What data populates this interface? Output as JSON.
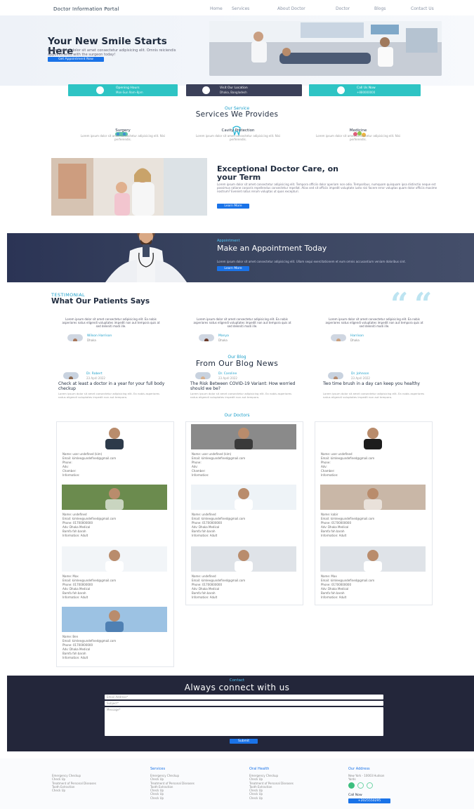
{
  "header": {
    "brand": "Doctor Information Portal",
    "nav": [
      "Home",
      "Services",
      "About Doctor",
      "Doctor",
      "Blogs",
      "Contact Us"
    ]
  },
  "hero": {
    "title": "Your New Smile Starts Here",
    "text": "Lorem ipsum dolor sit amet consectetur adipisicing elit. Omnis reiciendis appointments with the surgeon today!",
    "button": "Get Appointment Now"
  },
  "info_cards": [
    {
      "title": "Opening Hours",
      "sub": "Mon-Sun 9am–8pm",
      "color": "#2ec4c4",
      "icon": "clock-icon"
    },
    {
      "title": "Visit Our Location",
      "sub": "Dhaka, Bangladesh",
      "color": "#3b4059",
      "icon": "location-pin-icon"
    },
    {
      "title": "Call Us Now",
      "sub": "+880000000",
      "color": "#2ec4c4",
      "icon": "phone-icon"
    }
  ],
  "services": {
    "eyebrow": "Our Service",
    "title": "Services We Provides",
    "items": [
      {
        "name": "Surgery",
        "text": "Lorem ipsum dolor sit amet consectetur adipisicing elit. Nisi perferendis."
      },
      {
        "name": "Cavity Protection",
        "text": "Lorem ipsum dolor sit amet consectetur adipisicing elit. Nisi perferendis."
      },
      {
        "name": "Medicine",
        "text": "Lorem ipsum dolor sit amet consectetur adipisicing elit. Nisi perferendis."
      }
    ]
  },
  "exceptional": {
    "title": "Exceptional Doctor Care, on your Term",
    "text": "Lorem ipsum dolor sit amet consectetur adipisicing elit. Tempora officiis dolor aperiam non odio. Temporibus, numquam quisquam ipsa distinctio neque est possimus ratione corporis repellendus consectetur repellat. Alias sed sit officiis impedit voluptate iusto nisi facere error voluptas quam dolor officiis maxime nostrum? Eveniet natus rerum voluptas ut quos excepturi.",
    "button": "Learn More"
  },
  "appointment": {
    "eyebrow": "Appointment",
    "title": "Make an Appointment Today",
    "text": "Lorem ipsum dolor sit amet consectetur adipisicing elit. Ullam sequi exercitationem et eum omnis accusantium veniam doloribus sint.",
    "button": "Learn More"
  },
  "testimonial": {
    "eyebrow": "TESTIMONIAL",
    "title": "What Our Patients Says",
    "items": [
      {
        "text": "Lorem ipsum dolor sit amet consectetur adipisicing elit. Ea nobis asperiores natus eligendi voluptates impedit non aut tempora quis at sed deleniti modi ille.",
        "name": "Wilson Harrison",
        "role": "Dhaka"
      },
      {
        "text": "Lorem ipsum dolor sit amet consectetur adipisicing elit. Ea nobis asperiores natus eligendi voluptates impedit non aut tempora quis at sed deleniti modi ille.",
        "name": "Manya",
        "role": "Dhaka"
      },
      {
        "text": "Lorem ipsum dolor sit amet consectetur adipisicing elit. Ea nobis asperiores natus eligendi voluptates impedit non aut tempora quis at sed deleniti modi ille.",
        "name": "Harrison",
        "role": "Dhaka"
      }
    ]
  },
  "blog": {
    "eyebrow": "Our Blog",
    "title": "From Our Blog News",
    "posts": [
      {
        "author": "Dr. Robert",
        "date": "23 April 2022",
        "title": "Check at least a doctor in a year for your full body checkup",
        "excerpt": "Lorem ipsum dolor sit amet consectetur adipisicing elit. Ea nobis asperiores natus eligendi voluptates impedit non aut tempora."
      },
      {
        "author": "Dr. Caroline",
        "date": "23 April 2022",
        "title": "The Risk Between COVID-19 Variant: How worried should we be?",
        "excerpt": "Lorem ipsum dolor sit amet consectetur adipisicing elit. Ea nobis asperiores natus eligendi voluptates impedit non aut tempora."
      },
      {
        "author": "Dr. Johnson",
        "date": "23 April 2022",
        "title": "Two time brush in a day can keep you healthy",
        "excerpt": "Lorem ipsum dolor sit amet consectetur adipisicing elit. Ea nobis asperiores natus eligendi voluptates impedit non aut tempora."
      }
    ]
  },
  "doctors": {
    "eyebrow": "Our Doctors",
    "items": [
      {
        "name": "Name: user undefined (kim)",
        "email": "Email: kimlee@undefined@gmail.com",
        "phone": "Phone: ",
        "loc": "Adv: ",
        "chamber": "Chamber: ",
        "info": "Information: "
      },
      {
        "name": "Name: user undefined (kim)",
        "email": "Email: kimlee@undefined@gmail.com",
        "phone": "Phone: ",
        "loc": "Adv: ",
        "chamber": "Chamber: ",
        "info": "Information: "
      },
      {
        "name": "Name: user undefined",
        "email": "Email: kimlee@undefined@gmail.com",
        "phone": "Phone: ",
        "loc": "Adv: ",
        "chamber": "Chamber: ",
        "info": "Information: "
      },
      {
        "name": "Name: undefined",
        "email": "Email: kimlee@undefined@gmail.com",
        "phone": "Phone: 01700000000",
        "loc": "Adv: Dhaka Medical",
        "chamber": "Bamfa fah barah",
        "info": "Information: Adult"
      },
      {
        "name": "Name: undefined",
        "email": "Email: kimlee@undefined@gmail.com",
        "phone": "Phone: 01700000000",
        "loc": "Adv: Dhaka Medical",
        "chamber": "Bamfa fah barah",
        "info": "Information: Adult"
      },
      {
        "name": "Name: kabir",
        "email": "Email: kimlee@undefined@gmail.com",
        "phone": "Phone: 01700000000",
        "loc": "Adv: Dhaka Medical",
        "chamber": "Bamfa fah barah",
        "info": "Information: Adult"
      },
      {
        "name": "Name: Max",
        "email": "Email: kimlee@undefined@gmail.com",
        "phone": "Phone: 01700000000",
        "loc": "Adv: Dhaka Medical",
        "chamber": "Bamfa fah barah",
        "info": "Information: Adult"
      },
      {
        "name": "Name: undefined",
        "email": "Email: kimlee@undefined@gmail.com",
        "phone": "Phone: 01700000000",
        "loc": "Adv: Dhaka Medical",
        "chamber": "Bamfa fah barah",
        "info": "Information: Adult"
      },
      {
        "name": "Name: Max",
        "email": "Email: kimlee@undefined@gmail.com",
        "phone": "Phone: 01700000000",
        "loc": "Adv: Dhaka Medical",
        "chamber": "Bamfa fah barah",
        "info": "Information: Adult"
      },
      {
        "name": "Name: Ben",
        "email": "Email: kimlee@undefined@gmail.com",
        "phone": "Phone: 01700000000",
        "loc": "Adv: Dhaka Medical",
        "chamber": "Bamfa fah barah",
        "info": "Information: Adult"
      }
    ]
  },
  "contact": {
    "eyebrow": "Contact",
    "title": "Always connect with us",
    "email_ph": "Email Address*",
    "subject_ph": "Subject*",
    "message_ph": "Message*",
    "button": "Submit"
  },
  "footer": {
    "cols": [
      {
        "title": "",
        "links": [
          "Emergency Checkup",
          "Check Up",
          "Treatment of Personal Diseases",
          "Tooth Extraction",
          "Check Up"
        ]
      },
      {
        "title": "Services",
        "links": [
          "Emergency Checkup",
          "Check Up",
          "Treatment of Personal Diseases",
          "Tooth Extraction",
          "Check Up",
          "Check Up",
          "Check Up"
        ]
      },
      {
        "title": "Oral Health",
        "links": [
          "Emergency Checkup",
          "Check Up",
          "Treatment of Personal Diseases",
          "Tooth Extraction",
          "Check Up",
          "Check Up",
          "Check Up"
        ]
      },
      {
        "title": "Our Address",
        "links": [
          "New York - 10003 Hudson",
          "Yards"
        ]
      }
    ],
    "call_label": "Call Now",
    "call_button": "+2025550295"
  }
}
